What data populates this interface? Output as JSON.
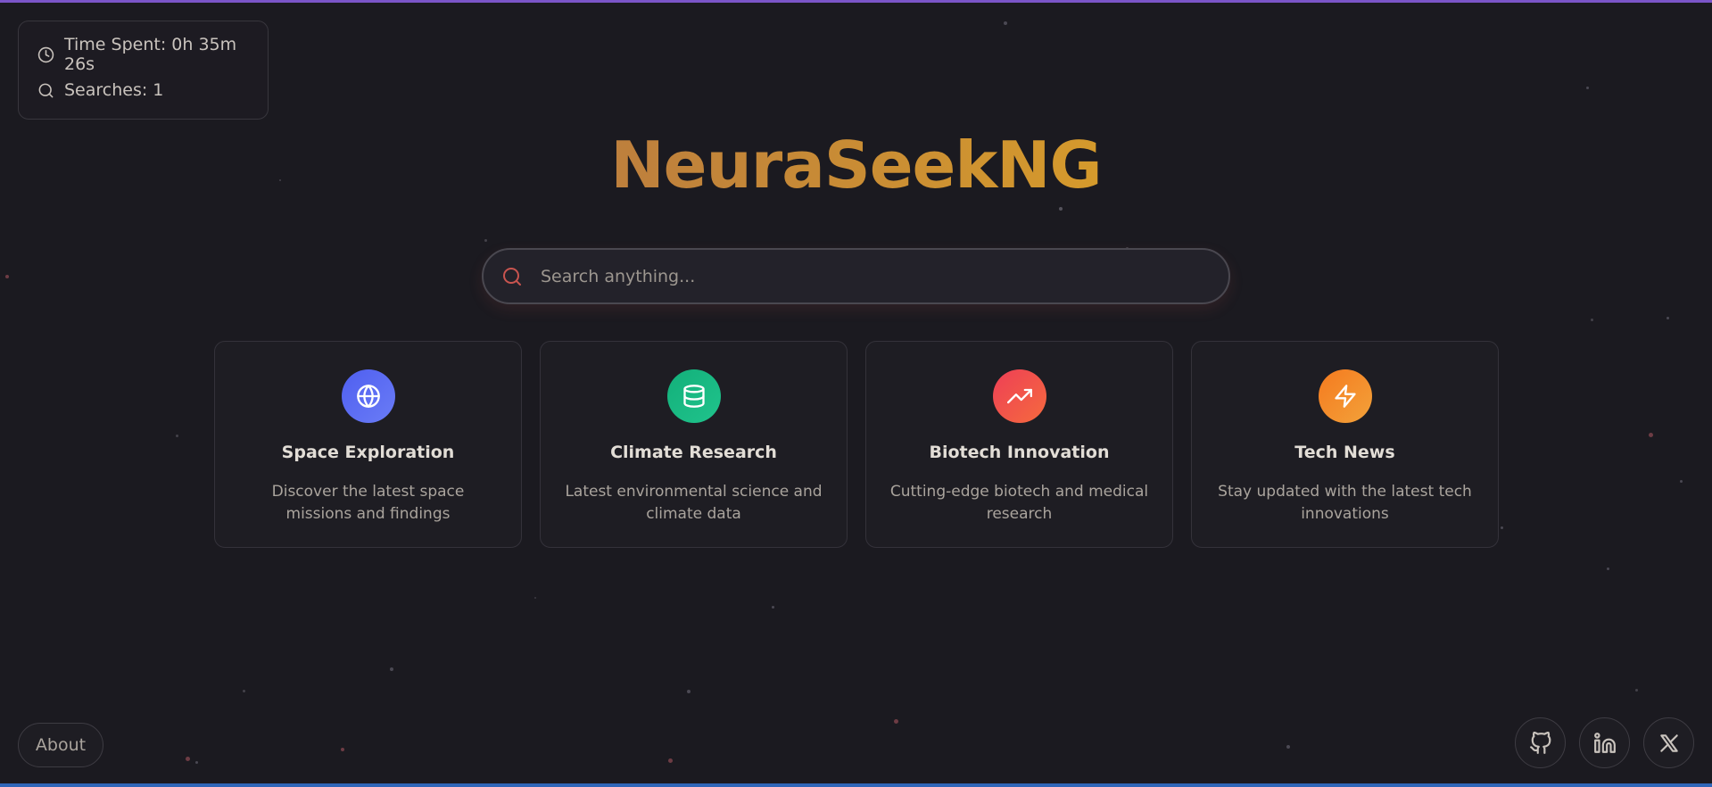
{
  "app": {
    "title": "NeuraSeekNG"
  },
  "stats": {
    "time_spent": "Time Spent: 0h 35m 26s",
    "searches": "Searches: 1",
    "time_icon": "clock-icon",
    "searches_icon": "search-icon"
  },
  "search": {
    "placeholder": "Search anything...",
    "value": "",
    "icon": "search-icon"
  },
  "cards": [
    {
      "title": "Space Exploration",
      "description": "Discover the latest space missions and findings",
      "icon": "globe-icon",
      "color_start": "#4f5ff0",
      "color_end": "#6a7cf6"
    },
    {
      "title": "Climate Research",
      "description": "Latest environmental science and climate data",
      "icon": "database-icon",
      "color_start": "#13b07a",
      "color_end": "#20c38c"
    },
    {
      "title": "Biotech Innovation",
      "description": "Cutting-edge biotech and medical research",
      "icon": "trending-up-icon",
      "color_start": "#ee3f56",
      "color_end": "#f56a3e"
    },
    {
      "title": "Tech News",
      "description": "Stay updated with the latest tech innovations",
      "icon": "zap-icon",
      "color_start": "#f47a1f",
      "color_end": "#f3a23a"
    }
  ],
  "footer": {
    "about_label": "About",
    "social": [
      "github-icon",
      "linkedin-icon",
      "x-icon"
    ]
  },
  "colors": {
    "background": "#1b1a20",
    "title_start": "#bd7f3d",
    "title_end": "#d59a2c",
    "accent_search": "#c8544f",
    "top_bar": "#7b55c8",
    "bottom_bar": "#2f66b8"
  }
}
